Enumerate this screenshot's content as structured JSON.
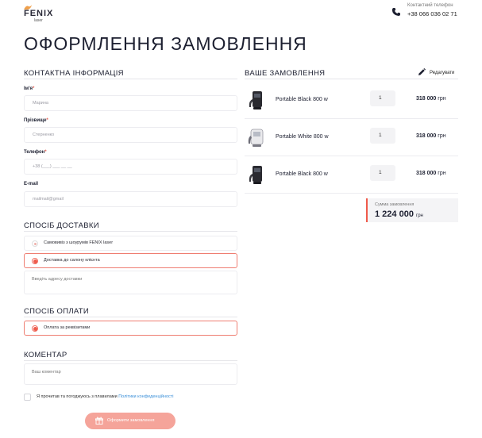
{
  "header": {
    "logo_text": "FENIX",
    "logo_sub": "laser",
    "phone_label": "Контактний телефон",
    "phone_number": "+38 066 036 02 71"
  },
  "page_title": "ОФОРМЛЕННЯ ЗАМОВЛЕННЯ",
  "contact": {
    "title": "КОНТАКТНА ІНФОРМАЦІЯ",
    "name_label": "Ім'я",
    "name_placeholder": "Марина",
    "surname_label": "Прізвище",
    "surname_placeholder": "Стерненко",
    "phone_label": "Телефон",
    "phone_placeholder": "+38 (___) ___ __ __",
    "email_label": "E-mail",
    "email_placeholder": "mailmail@gmail",
    "required_mark": "*"
  },
  "delivery": {
    "title": "СПОСІБ ДОСТАВКИ",
    "options": [
      {
        "label": "Самовивіз з шоурумів FENIX laser",
        "selected": false
      },
      {
        "label": "Доставка до салону клієнта",
        "selected": true
      }
    ],
    "address_placeholder": "Введіть адресу доставки"
  },
  "payment": {
    "title": "СПОСІБ ОПЛАТИ",
    "options": [
      {
        "label": "Оплата за реквізитами",
        "selected": true
      }
    ]
  },
  "comment": {
    "title": "КОМЕНТАР",
    "placeholder": "Ваш коментар"
  },
  "consent": {
    "text": "Я прочитав та погоджуюсь з плавилами ",
    "link": "Політики конфеденційності"
  },
  "submit_label": "Оформити замовлення",
  "order": {
    "title": "ВАШЕ ЗАМОВЛЕННЯ",
    "edit_label": "Редагувати",
    "items": [
      {
        "name": "Portable Black 800 w",
        "qty": "1",
        "price": "318 000",
        "currency": "грн",
        "icon": "device-black-icon"
      },
      {
        "name": "Portable White 800 w",
        "qty": "1",
        "price": "318 000",
        "currency": "грн",
        "icon": "device-white-icon"
      },
      {
        "name": "Portable Black 800 w",
        "qty": "1",
        "price": "318 000",
        "currency": "грн",
        "icon": "device-black-icon"
      }
    ],
    "total_label": "Сумма замовлення",
    "total_value": "1 224 000",
    "total_currency": "грн"
  },
  "colors": {
    "accent": "#ef5a4b",
    "button": "#f5a49a",
    "link": "#3a8fd8"
  }
}
